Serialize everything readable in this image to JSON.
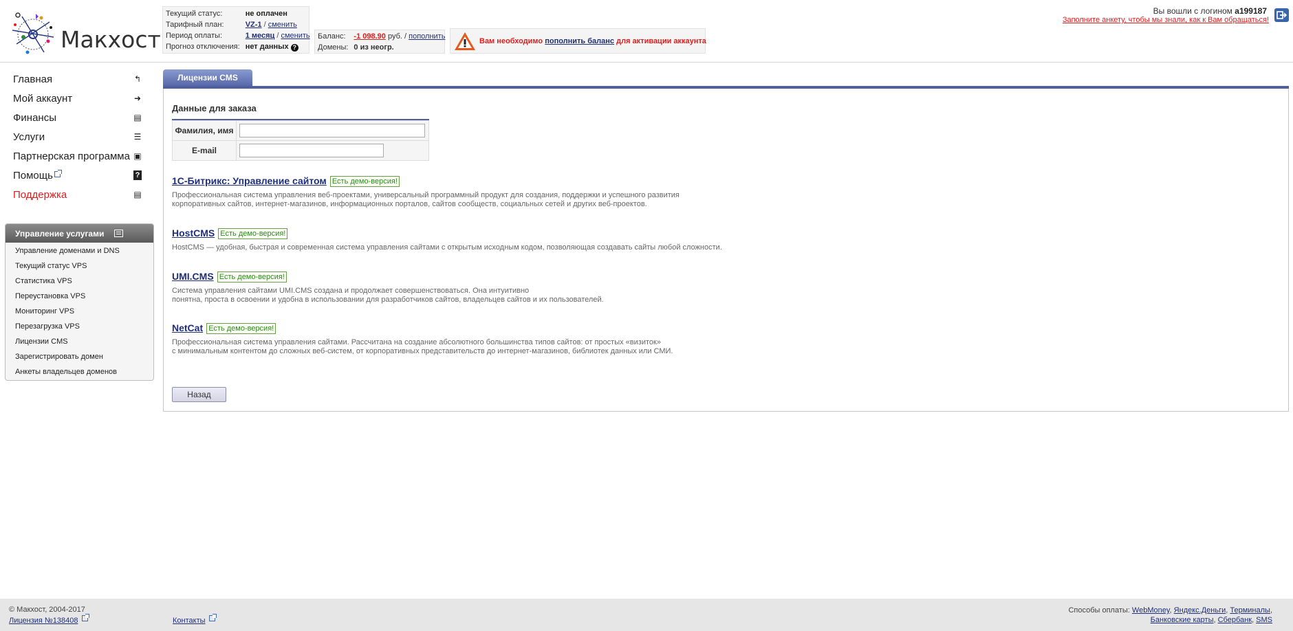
{
  "header": {
    "logo_text": "Макхост",
    "status": {
      "current_status_label": "Текущий статус:",
      "current_status_value": "не оплачен",
      "tariff_label": "Тарифный план:",
      "tariff_value": "VZ-1",
      "tariff_change": "сменить",
      "period_label": "Период оплаты:",
      "period_value": "1 месяц",
      "period_change": "сменить",
      "forecast_label": "Прогноз отключения:",
      "forecast_value": "нет данных"
    },
    "balance": {
      "balance_label": "Баланс:",
      "balance_value": "-1 098.90",
      "currency": "руб.",
      "topup_link": "пополнить",
      "domains_label": "Домены:",
      "domains_value": "0 из неогр."
    },
    "warning": {
      "text_before": "Вам необходимо",
      "link": "пополнить баланс",
      "text_after": "для активации аккаунта"
    },
    "login": {
      "text": "Вы вошли с логином",
      "username": "a199187",
      "profile_link": "Заполните анкету, чтобы мы знали, как к Вам обращаться!"
    }
  },
  "menu": [
    {
      "label": "Главная",
      "icon": "home-arrow-icon"
    },
    {
      "label": "Мой аккаунт",
      "icon": "account-icon"
    },
    {
      "label": "Финансы",
      "icon": "finance-icon"
    },
    {
      "label": "Услуги",
      "icon": "services-icon"
    },
    {
      "label": "Партнерская программа",
      "icon": "partner-icon"
    },
    {
      "label": "Помощь",
      "icon": "help-icon"
    },
    {
      "label": "Поддержка",
      "icon": "support-icon"
    }
  ],
  "services_panel": {
    "title": "Управление услугами",
    "items": [
      "Управление доменами и DNS",
      "Текущий статус VPS",
      "Статистика VPS",
      "Переустановка VPS",
      "Мониторинг VPS",
      "Перезагрузка VPS",
      "Лицензии CMS",
      "Зарегистрировать домен",
      "Анкеты владельцев доменов"
    ]
  },
  "main": {
    "tab_label": "Лицензии CMS",
    "section_title": "Данные для заказа",
    "form": {
      "name_label": "Фамилия, имя",
      "name_value": "",
      "email_label": "E-mail",
      "email_value": ""
    },
    "demo_badge": "Есть демо-версия!",
    "cms": [
      {
        "title": "1С-Битрикс: Управление сайтом",
        "desc1": "Профессиональная система управления веб-проектами, универсальный программный продукт для создания, поддержки и успешного развития",
        "desc2": "корпоративных сайтов, интернет-магазинов, информационных порталов, сайтов сообществ, социальных сетей и других веб-проектов."
      },
      {
        "title": "HostCMS",
        "desc1": "HostCMS — удобная, быстрая и современная система управления сайтами с открытым исходным кодом, позволяющая создавать сайты любой сложности.",
        "desc2": ""
      },
      {
        "title": "UMI.CMS",
        "desc1": "Система управления сайтами UMI.CMS создана и продолжает совершенствоваться. Она интуитивно",
        "desc2": "понятна, проста в освоении и удобна в использовании для разработчиков сайтов, владельцев сайтов и их пользователей."
      },
      {
        "title": "NetCat",
        "desc1": "Профессиональная система управления сайтами. Рассчитана на создание абсолютного большинства типов сайтов: от простых «визиток»",
        "desc2": "с минимальным контентом до сложных веб-систем, от корпоративных представительств до интернет-магазинов, библиотек данных или СМИ."
      }
    ],
    "back_button": "Назад"
  },
  "footer": {
    "copyright": "© Макхост, 2004-2017",
    "license": "Лицензия №138408",
    "contacts": "Контакты",
    "payments_label": "Способы оплаты:",
    "payments": [
      "WebMoney",
      "Яндекс.Деньги",
      "Терминалы",
      "Банковские карты",
      "Сбербанк",
      "SMS"
    ]
  },
  "colors": {
    "accent_blue": "#4f5fa0",
    "link": "#1f2f7a",
    "alert_red": "#e01d1d",
    "demo_green": "#2d8a1d"
  }
}
